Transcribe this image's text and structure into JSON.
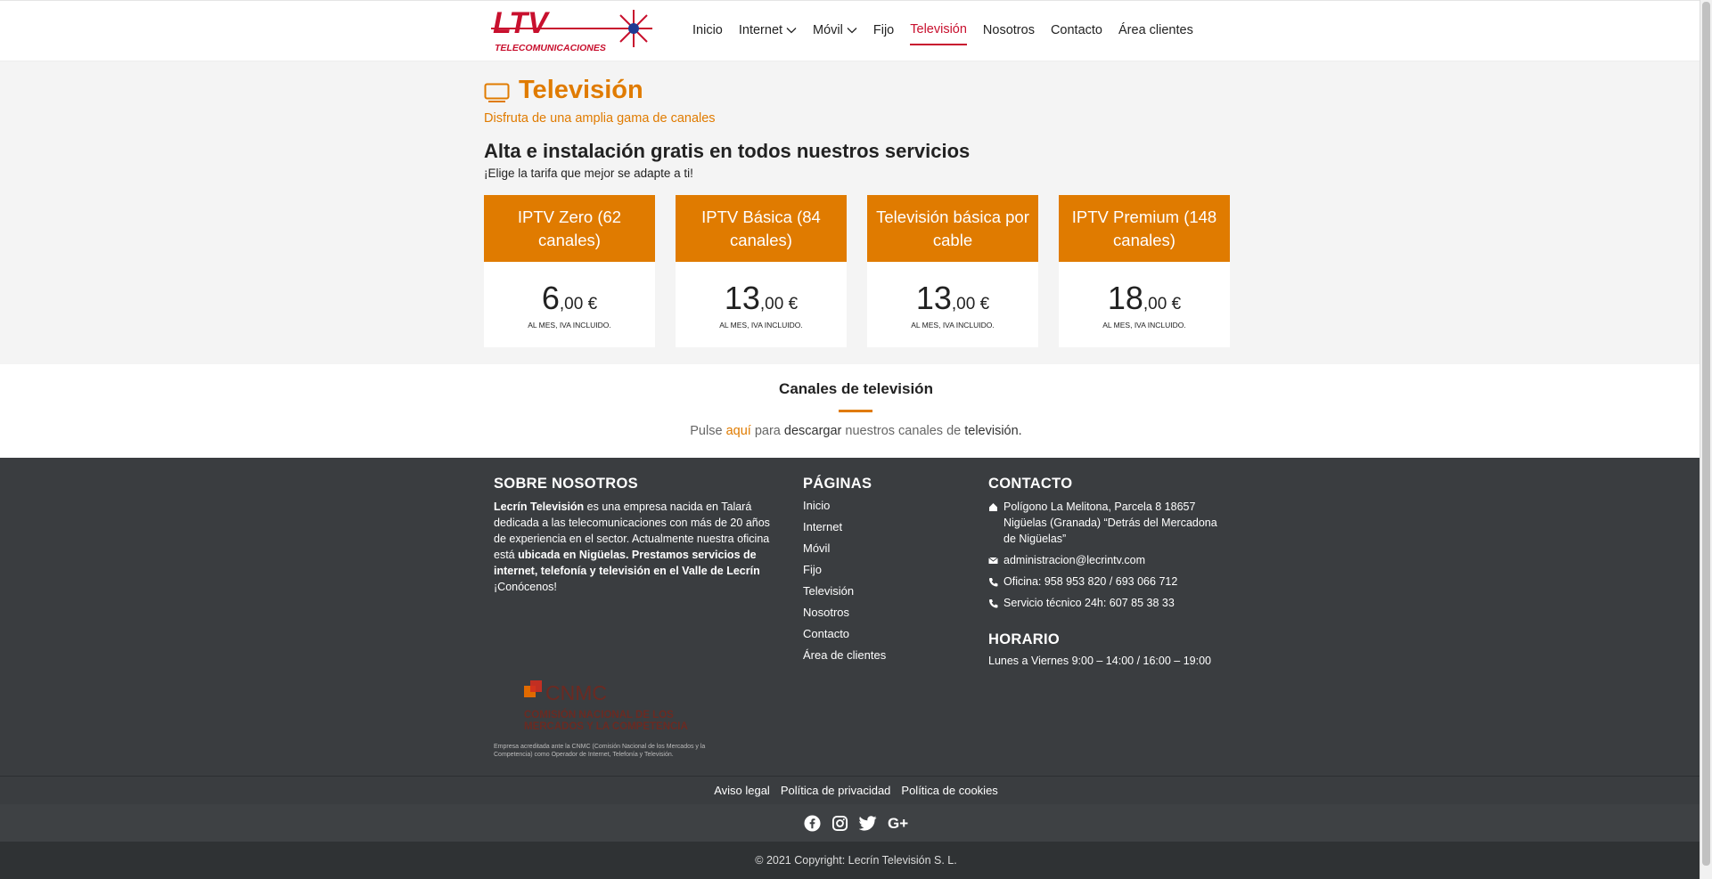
{
  "header": {
    "logo_text": "LTV",
    "logo_subtext": "TELECOMUNICACIONES",
    "nav": [
      {
        "label": "Inicio",
        "dropdown": false,
        "active": false
      },
      {
        "label": "Internet",
        "dropdown": true,
        "active": false
      },
      {
        "label": "Móvil",
        "dropdown": true,
        "active": false
      },
      {
        "label": "Fijo",
        "dropdown": false,
        "active": false
      },
      {
        "label": "Televisión",
        "dropdown": false,
        "active": true
      },
      {
        "label": "Nosotros",
        "dropdown": false,
        "active": false
      },
      {
        "label": "Contacto",
        "dropdown": false,
        "active": false
      },
      {
        "label": "Área clientes",
        "dropdown": false,
        "active": false
      }
    ]
  },
  "hero": {
    "icon": "tv-icon",
    "title": "Televisión",
    "subtitle": "Disfruta de una amplia gama de canales",
    "headline": "Alta e instalación gratis en todos nuestros servicios",
    "subheadline": "¡Elige la tarifa que mejor se adapte a ti!"
  },
  "plans": [
    {
      "name": "IPTV Zero (62 canales)",
      "price_int": "6",
      "price_dec": ",00 €",
      "note": "AL MES, IVA INCLUIDO."
    },
    {
      "name": "IPTV Básica (84 canales)",
      "price_int": "13",
      "price_dec": ",00 €",
      "note": "AL MES, IVA INCLUIDO."
    },
    {
      "name": "Televisión básica por cable",
      "price_int": "13",
      "price_dec": ",00 €",
      "note": "AL MES, IVA INCLUIDO."
    },
    {
      "name": "IPTV Premium (148 canales)",
      "price_int": "18",
      "price_dec": ",00 €",
      "note": "AL MES, IVA INCLUIDO."
    }
  ],
  "channels": {
    "title": "Canales de televisión",
    "text_1": "Pulse ",
    "link": "aquí",
    "text_2": " para ",
    "text_3": "descargar",
    "text_4": " nuestros canales de ",
    "text_5": "televisión."
  },
  "footer": {
    "about_title": "SOBRE NOSOTROS",
    "about_bold_1": "Lecrín Televisión",
    "about_text_1": " es una empresa nacida en Talará dedicada a las telecomunicaciones con más de 20 años de experiencia en el sector. Actualmente nuestra oficina está ",
    "about_bold_2": "ubicada en Nigüelas. Prestamos servicios de internet, telefonía y televisión en el Valle de Lecrín",
    "about_text_2": " ¡Conócenos!",
    "pages_title": "PÁGINAS",
    "pages": [
      "Inicio",
      "Internet",
      "Móvil",
      "Fijo",
      "Televisión",
      "Nosotros",
      "Contacto",
      "Área de clientes"
    ],
    "contact_title": "CONTACTO",
    "address": "Polígono La Melitona, Parcela 8 18657 Nigüelas (Granada) “Detrás del Mercadona de Nigüelas”",
    "email": "administracion@lecrintv.com",
    "phone_office": "Oficina: 958 953 820 / 693 066 712",
    "phone_support": "Servicio técnico 24h: 607 85 38 33",
    "schedule_title": "HORARIO",
    "schedule": "Lunes a Viernes 9:00 – 14:00 / 16:00 – 19:00",
    "cnmc_line1": "CNMC",
    "cnmc_line2": "COMISIÓN NACIONAL DE LOS",
    "cnmc_line3": "MERCADOS Y LA COMPETENCIA",
    "cnmc_caption": "Empresa acreditada ante la CNMC (Comisión Nacional de los Mercados y la Competencia) como Operador de Internet, Telefonía y Televisión.",
    "legal_links": [
      "Aviso legal",
      "Política de privacidad",
      "Política de cookies"
    ],
    "social_icons": [
      "facebook-icon",
      "instagram-icon",
      "twitter-icon",
      "google-plus-icon"
    ],
    "copyright": "© 2021 Copyright: Lecrín Televisión S. L."
  },
  "colors": {
    "accent": "#e07b00",
    "active_nav": "#c8102e",
    "footer_bg": "#3a3d40",
    "hero_bg": "#f4f4f4"
  }
}
